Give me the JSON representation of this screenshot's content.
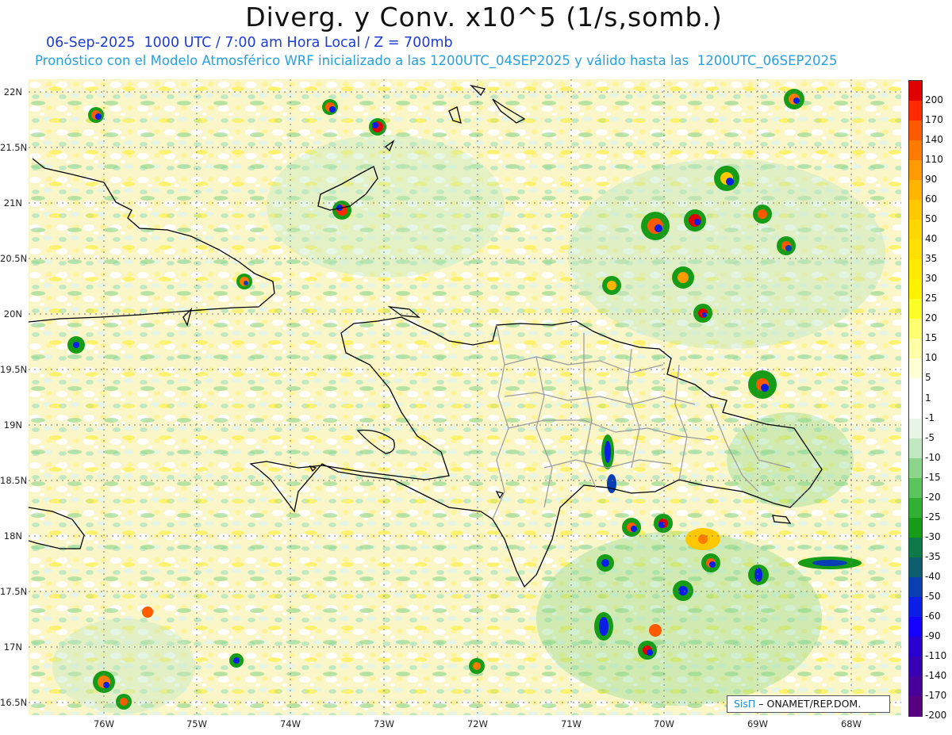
{
  "title": "Diverg. y Conv. x10^5 (1/s,somb.)",
  "subtitle": "06-Sep-2025  1000 UTC / 7:00 am Hora Local / Z = 700mb",
  "info": "Pronóstico con el Modelo Atmosférico WRF inicializado a las 1200UTC_04SEP2025 y válido hasta las  1200UTC_06SEP2025",
  "credit": {
    "logo": "SisΠ",
    "text": " – ONAMET/REP.DOM."
  },
  "axes": {
    "lat_labels": [
      "22N",
      "21.5N",
      "21N",
      "20.5N",
      "20N",
      "19.5N",
      "19N",
      "18.5N",
      "18N",
      "17.5N",
      "17N",
      "16.5N"
    ],
    "lon_labels": [
      "76W",
      "75W",
      "74W",
      "73W",
      "72W",
      "71W",
      "70W",
      "69W",
      "68W"
    ]
  },
  "colorbar": {
    "levels": [
      {
        "label": "200",
        "color": "#e00000"
      },
      {
        "label": "170",
        "color": "#ff2a00"
      },
      {
        "label": "140",
        "color": "#ff5a00"
      },
      {
        "label": "110",
        "color": "#ff7a00"
      },
      {
        "label": "90",
        "color": "#ff9a00"
      },
      {
        "label": "60",
        "color": "#ffb400"
      },
      {
        "label": "50",
        "color": "#ffc800"
      },
      {
        "label": "40",
        "color": "#ffd700"
      },
      {
        "label": "35",
        "color": "#ffe000"
      },
      {
        "label": "30",
        "color": "#ffeb00"
      },
      {
        "label": "25",
        "color": "#fff200"
      },
      {
        "label": "20",
        "color": "#ffff28"
      },
      {
        "label": "15",
        "color": "#ffff70"
      },
      {
        "label": "10",
        "color": "#ffffa8"
      },
      {
        "label": "5",
        "color": "#ffffd6"
      },
      {
        "label": "1",
        "color": "#ffffff"
      },
      {
        "label": "-1",
        "color": "#ffffff"
      },
      {
        "label": "-5",
        "color": "#e6f5e6"
      },
      {
        "label": "-10",
        "color": "#c2e8c2"
      },
      {
        "label": "-15",
        "color": "#8cd68c"
      },
      {
        "label": "-20",
        "color": "#5cc45c"
      },
      {
        "label": "-25",
        "color": "#32b032"
      },
      {
        "label": "-30",
        "color": "#169c16"
      },
      {
        "label": "-35",
        "color": "#0e7a4a"
      },
      {
        "label": "-40",
        "color": "#0b5e6e"
      },
      {
        "label": "-50",
        "color": "#0a3fb4"
      },
      {
        "label": "-60",
        "color": "#0a1ee6"
      },
      {
        "label": "-90",
        "color": "#1400ff"
      },
      {
        "label": "-110",
        "color": "#2800d2"
      },
      {
        "label": "-140",
        "color": "#3800b4"
      },
      {
        "label": "-170",
        "color": "#48009a"
      },
      {
        "label": "-200",
        "color": "#580082"
      }
    ]
  }
}
